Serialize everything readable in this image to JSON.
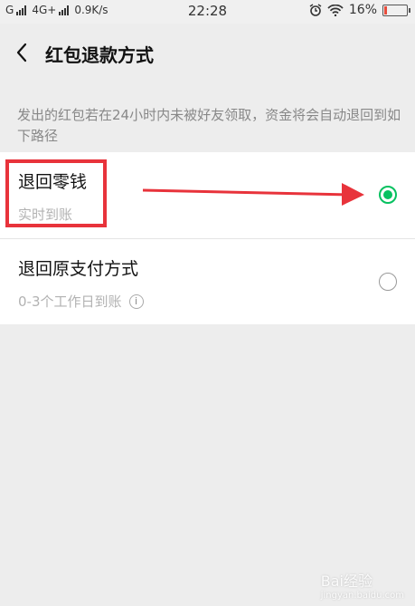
{
  "status_bar": {
    "carrier": "G",
    "network": "4G+",
    "speed": "0.9K/s",
    "time": "22:28",
    "battery": "16%"
  },
  "nav": {
    "title": "红包退款方式"
  },
  "description": "发出的红包若在24小时内未被好友领取，资金将会自动退回到如下路径",
  "options": [
    {
      "title": "退回零钱",
      "subtitle": "实时到账",
      "selected": true
    },
    {
      "title": "退回原支付方式",
      "subtitle": "0-3个工作日到账",
      "selected": false
    }
  ],
  "watermark": {
    "text": "Bai经验",
    "sub": "jingyan.baidu.com"
  },
  "colors": {
    "accent": "#07c160",
    "annotation": "#e8333b"
  }
}
